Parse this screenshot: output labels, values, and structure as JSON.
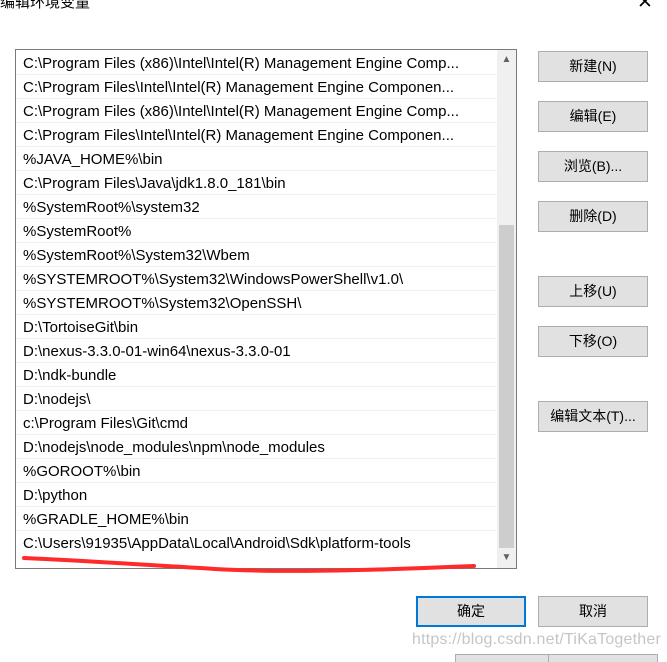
{
  "window": {
    "title": "编辑环境变量",
    "close_glyph": "✕"
  },
  "path_list": {
    "items": [
      "C:\\Program Files (x86)\\Intel\\Intel(R) Management Engine Comp...",
      "C:\\Program Files\\Intel\\Intel(R) Management Engine Componen...",
      "C:\\Program Files (x86)\\Intel\\Intel(R) Management Engine Comp...",
      "C:\\Program Files\\Intel\\Intel(R) Management Engine Componen...",
      "%JAVA_HOME%\\bin",
      "C:\\Program Files\\Java\\jdk1.8.0_181\\bin",
      "%SystemRoot%\\system32",
      "%SystemRoot%",
      "%SystemRoot%\\System32\\Wbem",
      "%SYSTEMROOT%\\System32\\WindowsPowerShell\\v1.0\\",
      "%SYSTEMROOT%\\System32\\OpenSSH\\",
      "D:\\TortoiseGit\\bin",
      "D:\\nexus-3.3.0-01-win64\\nexus-3.3.0-01",
      "D:\\ndk-bundle",
      "D:\\nodejs\\",
      "c:\\Program Files\\Git\\cmd",
      "D:\\nodejs\\node_modules\\npm\\node_modules",
      "%GOROOT%\\bin",
      "D:\\python",
      "%GRADLE_HOME%\\bin",
      "C:\\Users\\91935\\AppData\\Local\\Android\\Sdk\\platform-tools"
    ],
    "scroll_up_glyph": "▲",
    "scroll_down_glyph": "▼"
  },
  "buttons": {
    "new": "新建(N)",
    "edit": "编辑(E)",
    "browse": "浏览(B)...",
    "delete": "删除(D)",
    "move_up": "上移(U)",
    "move_down": "下移(O)",
    "edit_text": "编辑文本(T)...",
    "ok": "确定",
    "cancel": "取消"
  },
  "watermark": "https://blog.csdn.net/TiKaTogether",
  "colors": {
    "annotation_red": "#ff2a2a",
    "primary_border": "#0078d7",
    "button_bg": "#e1e1e1"
  }
}
